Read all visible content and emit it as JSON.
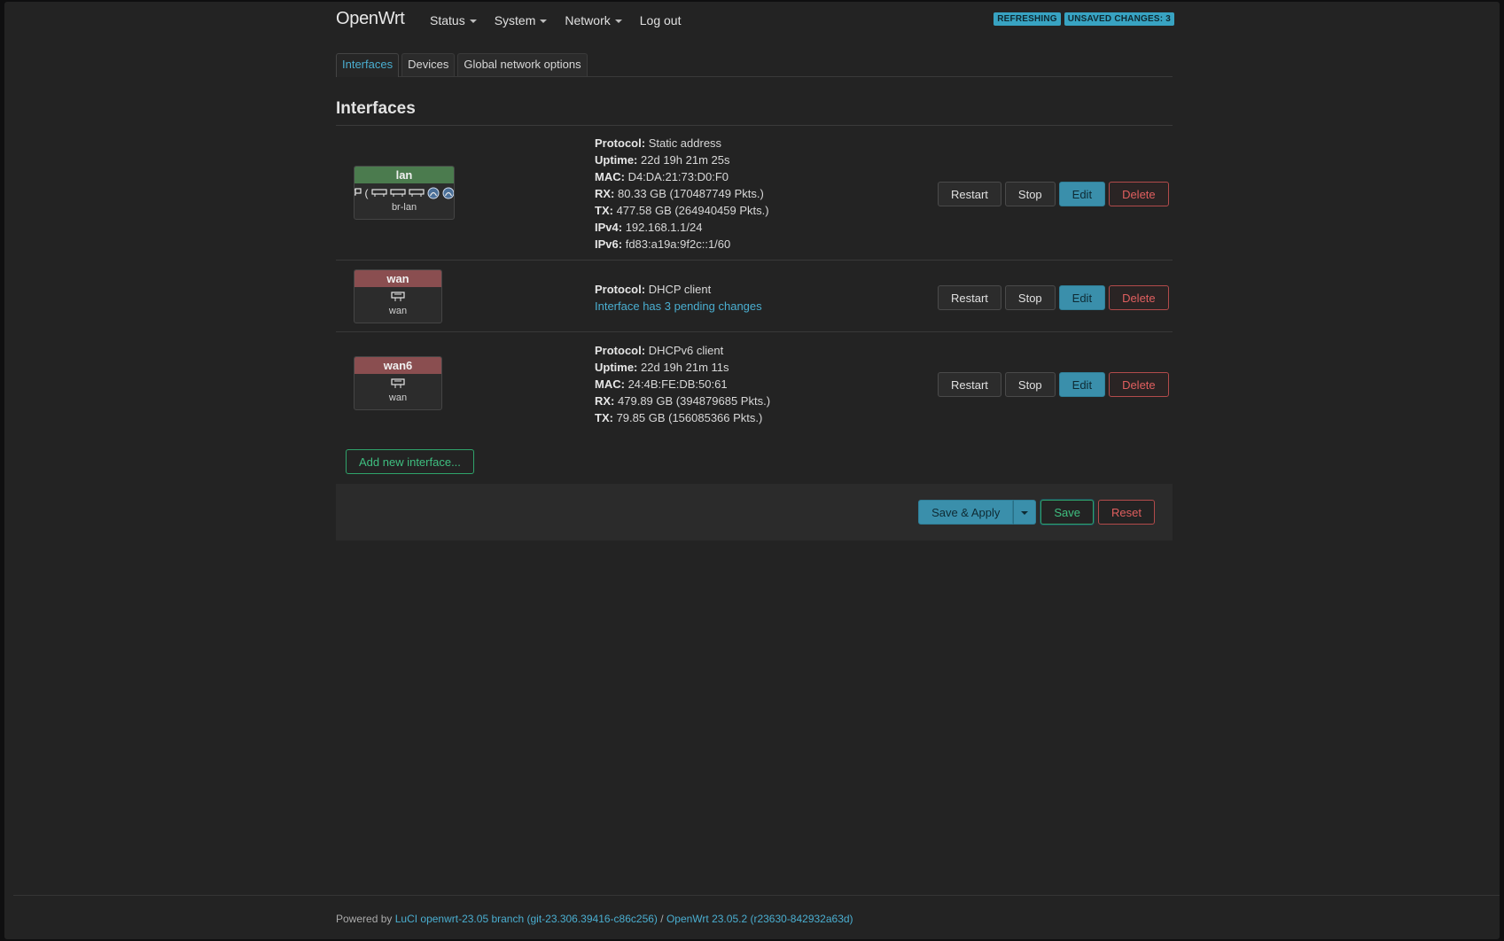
{
  "brand": "OpenWrt",
  "menu": [
    {
      "label": "Status",
      "dropdown": true
    },
    {
      "label": "System",
      "dropdown": true
    },
    {
      "label": "Network",
      "dropdown": true
    },
    {
      "label": "Log out",
      "dropdown": false
    }
  ],
  "indicators": {
    "refreshing": "REFRESHING",
    "unsaved": "UNSAVED CHANGES: 3"
  },
  "tabs": [
    {
      "label": "Interfaces",
      "active": true
    },
    {
      "label": "Devices",
      "active": false
    },
    {
      "label": "Global network options",
      "active": false
    }
  ],
  "section_title": "Interfaces",
  "interfaces": [
    {
      "name": "lan",
      "device": "br-lan",
      "status_color": "#4b7b4e",
      "icons": [
        "bridge-icon",
        "ethernet-port-icon",
        "ethernet-port-icon",
        "ethernet-port-icon",
        "wifi-icon",
        "wifi-icon"
      ],
      "details": [
        {
          "label": "Protocol:",
          "value": "Static address"
        },
        {
          "label": "Uptime:",
          "value": "22d 19h 21m 25s"
        },
        {
          "label": "MAC:",
          "value": "D4:DA:21:73:D0:F0"
        },
        {
          "label": "RX:",
          "value": "80.33 GB (170487749 Pkts.)"
        },
        {
          "label": "TX:",
          "value": "477.58 GB (264940459 Pkts.)"
        },
        {
          "label": "IPv4:",
          "value": "192.168.1.1/24"
        },
        {
          "label": "IPv6:",
          "value": "fd83:a19a:9f2c::1/60"
        }
      ]
    },
    {
      "name": "wan",
      "device": "wan",
      "status_color": "#8a4e50",
      "icons": [
        "ethernet-port-icon"
      ],
      "details": [
        {
          "label": "Protocol:",
          "value": "DHCP client"
        }
      ],
      "pending": "Interface has 3 pending changes"
    },
    {
      "name": "wan6",
      "device": "wan",
      "status_color": "#8a4e50",
      "icons": [
        "ethernet-port-icon"
      ],
      "details": [
        {
          "label": "Protocol:",
          "value": "DHCPv6 client"
        },
        {
          "label": "Uptime:",
          "value": "22d 19h 21m 11s"
        },
        {
          "label": "MAC:",
          "value": "24:4B:FE:DB:50:61"
        },
        {
          "label": "RX:",
          "value": "479.89 GB (394879685 Pkts.)"
        },
        {
          "label": "TX:",
          "value": "79.85 GB (156085366 Pkts.)"
        }
      ]
    }
  ],
  "row_actions": {
    "restart": "Restart",
    "stop": "Stop",
    "edit": "Edit",
    "delete": "Delete"
  },
  "add_interface": "Add new interface...",
  "footer_actions": {
    "save_apply": "Save & Apply",
    "save": "Save",
    "reset": "Reset"
  },
  "page_footer": {
    "prefix": "Powered by",
    "luci_link": "LuCI openwrt-23.05 branch (git-23.306.39416-c86c256)",
    "separator": "/",
    "openwrt_link": "OpenWrt 23.05.2 (r23630-842932a63d)"
  },
  "colors": {
    "accent": "#4aaed0",
    "success": "#3fbf80",
    "danger": "#e05f5f",
    "up": "#4b7b4e",
    "down": "#8a4e50"
  }
}
